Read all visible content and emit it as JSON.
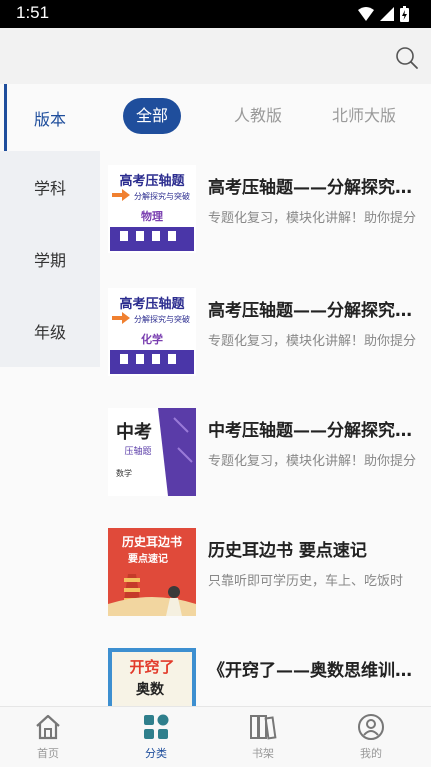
{
  "status": {
    "time": "1:51"
  },
  "sidebar": {
    "items": [
      {
        "label": "版本"
      },
      {
        "label": "学科"
      },
      {
        "label": "学期"
      },
      {
        "label": "年级"
      }
    ]
  },
  "tabs": [
    {
      "label": "全部"
    },
    {
      "label": "人教版"
    },
    {
      "label": "北师大版"
    }
  ],
  "books": [
    {
      "title": "高考压轴题——分解探究与突破",
      "desc": "专题化复习，模块化讲解！助你提分",
      "cover": {
        "heading": "高考压轴题",
        "sub": "分解探究与突破",
        "subject": "物理"
      }
    },
    {
      "title": "高考压轴题——分解探究与突破",
      "desc": "专题化复习，模块化讲解！助你提分",
      "cover": {
        "heading": "高考压轴题",
        "sub": "分解探究与突破",
        "subject": "化学"
      }
    },
    {
      "title": "中考压轴题——分解探究与突破",
      "desc": "专题化复习，模块化讲解！助你提分",
      "cover": {
        "heading": "中考",
        "sub": "压轴题",
        "subject": "数学"
      }
    },
    {
      "title": "历史耳边书 要点速记",
      "desc": "只靠听即可学历史，车上、吃饭时",
      "cover": {
        "heading": "历史耳边书",
        "sub": "要点速记"
      }
    },
    {
      "title": "《开窍了——奥数思维训练》",
      "desc": "",
      "cover": {
        "heading": "开窍了",
        "sub": "奥数"
      }
    }
  ],
  "bottom_nav": [
    {
      "label": "首页",
      "icon": "home-icon"
    },
    {
      "label": "分类",
      "icon": "category-icon"
    },
    {
      "label": "书架",
      "icon": "bookshelf-icon"
    },
    {
      "label": "我的",
      "icon": "profile-icon"
    }
  ],
  "colors": {
    "accent": "#1f4e9c"
  }
}
